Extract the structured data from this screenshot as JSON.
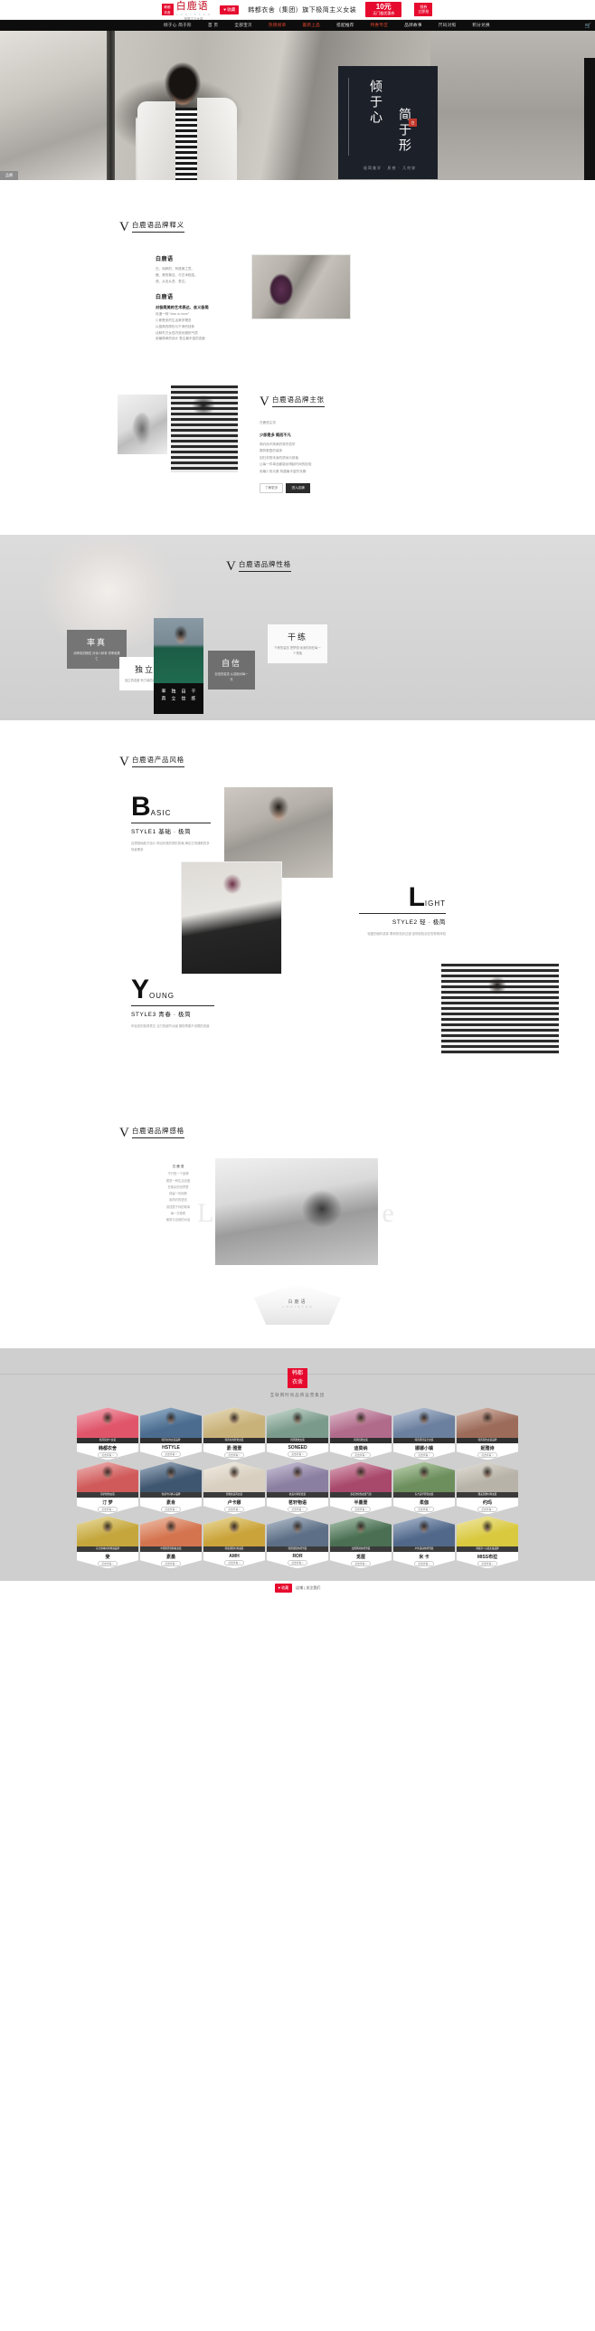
{
  "topbar": {
    "brand_badge": [
      "韩都",
      "衣舍"
    ],
    "brand_name": "白鹿语",
    "brand_pinyin": "L O U I S   T A O",
    "brand_tag": "极简主义女装",
    "fav_button": "♥ 收藏",
    "slogan": "韩都衣舍（集团）旗下极简主义女装",
    "coupon_amount": "10元",
    "coupon_condition": "无门槛优惠券",
    "coupon_tag_line1": "领券",
    "coupon_tag_line2": "立即抢"
  },
  "nav": {
    "items": [
      {
        "label": "倾于心 简于形",
        "hot": false
      },
      {
        "label": "首 页",
        "hot": false
      },
      {
        "label": "全部宝贝",
        "hot": false
      },
      {
        "label": "热销榜单",
        "hot": true
      },
      {
        "label": "最新上品",
        "hot": true
      },
      {
        "label": "搭配推荐",
        "hot": false
      },
      {
        "label": "特惠专区",
        "hot": true
      },
      {
        "label": "品牌故事",
        "hot": false
      },
      {
        "label": "尺码对照",
        "hot": false
      },
      {
        "label": "积分兑换",
        "hot": false
      }
    ],
    "cart_icon": "cart-icon"
  },
  "hero": {
    "title_line1": "倾于心",
    "title_line2": "简于形",
    "stamp": "白",
    "footnote": "极简美学 · 质感 · 几何穿",
    "tab_label": "品牌"
  },
  "section_definition": {
    "heading": "白鹿语品牌释义",
    "vmark": "V",
    "title": "白鹿语",
    "defs": [
      "白、纯粹的、有极简之意。",
      "鹿、美的象征、与艺术相连。",
      "语、从言从吾、表达。"
    ],
    "sub_title": "白鹿语",
    "sub_bold": "对极简美的艺术表达、含义极简",
    "paras": [
      "传递一种 \"less is more\"",
      "少即是多的生活美学理念",
      "以极简的廓形与干净的线条",
      "诠释东方女性内敛优雅的气质",
      "用最简单的设计 表达最丰富的态度"
    ]
  },
  "section_claim": {
    "heading": "白鹿语品牌主张",
    "vmark": "V",
    "bold": "少即是多 简而不凡",
    "paras": [
      "白鹿语主张",
      "简约而不简单的穿衣哲学",
      "摒弃繁复的装饰",
      "回归衣物本身的质地与剪裁",
      "让每一件单品都能经得起时间的检验",
      "用最少的元素 构建最丰富的衣橱"
    ],
    "buttons": [
      {
        "label": "了解更多",
        "primary": false
      },
      {
        "label": "进入店铺",
        "primary": true
      }
    ]
  },
  "section_personality": {
    "heading": "白鹿语品牌性格",
    "vmark": "V",
    "center_caption": [
      "率真",
      "独立",
      "自信",
      "干练"
    ],
    "traits": [
      {
        "title": "率真",
        "desc": "用率真的随性 对待人和事\n坦率而果仁"
      },
      {
        "title": "独立",
        "desc": "独立的态度\n有力量的自我表达"
      },
      {
        "title": "自信",
        "desc": "自信的姿态\n从容面对每一天"
      },
      {
        "title": "干练",
        "desc": "干练的姿态 把梦想\n深深的刻在每一个角落"
      }
    ]
  },
  "section_styles": {
    "heading": "白鹿语产品风格",
    "vmark": "V",
    "items": [
      {
        "letter": "B",
        "rest": "ASIC",
        "bar": "STYLE1 基础 · 极简",
        "desc": "百搭基础款式设计\n简洁利落的廓形剪裁\n满足日常通勤的多场景需求"
      },
      {
        "letter": "L",
        "rest": "IGHT",
        "bar": "STYLE2 轻 · 极简",
        "desc": "轻盈的面料选择\n柔和的色彩过渡\n呈现轻松自在的穿着体验"
      },
      {
        "letter": "Y",
        "rest": "OUNG",
        "bar": "STYLE3 青春 · 极简",
        "desc": "年轻态的极简表达\n活力的细节点缀\n展现青春不设限的态度"
      }
    ]
  },
  "section_feel": {
    "heading": "白鹿语品牌感格",
    "vmark": "V",
    "watermark": "Less is more",
    "text_lines": [
      "白 鹿 语",
      "不只是一个品牌",
      "更是一种生活态度",
      "在繁杂的世界里",
      "保留一份纯粹",
      "用简约的语言",
      "讲述属于你的故事",
      "每一次穿着",
      "都是与自我的对话"
    ],
    "logo_text": "白鹿语",
    "logo_sub": "L O U I S  T A O"
  },
  "footer": {
    "group_badge": [
      "韩都",
      "衣舍"
    ],
    "group_sub": "互联网时尚品牌运营集团",
    "rows": [
      [
        {
          "tagline": "韩风简约少女装",
          "name": "韩都衣舍",
          "enter": "点击查看 >"
        },
        {
          "tagline": "韩风时尚女装品牌",
          "name": "HSTYLE",
          "enter": "点击查看 >"
        },
        {
          "tagline": "韩风时尚轻奢女装",
          "name": "素·雅壹",
          "enter": "点击查看 >"
        },
        {
          "tagline": "韩风雅致女装",
          "name": "SONEED",
          "enter": "点击查看 >"
        },
        {
          "tagline": "韩风优雅女装",
          "name": "迪葵纳",
          "enter": "点击查看 >"
        },
        {
          "tagline": "韩风原创设计女装",
          "name": "娜娜小镇",
          "enter": "点击查看 >"
        },
        {
          "tagline": "韩风简约女装品牌",
          "name": "妮雅诗",
          "enter": "点击查看 >"
        }
      ],
      [
        {
          "tagline": "简约轻熟女装",
          "name": "汀 梦",
          "enter": "点击查看 >"
        },
        {
          "tagline": "性感牛仔裤子品牌",
          "name": "素肯",
          "enter": "点击查看 >"
        },
        {
          "tagline": "优雅欧美风女装",
          "name": "卢卡娜",
          "enter": "点击查看 >"
        },
        {
          "tagline": "欧美时尚宴会装",
          "name": "茗轩物语",
          "enter": "点击查看 >"
        },
        {
          "tagline": "多层次知性女装气质",
          "name": "半墨壹",
          "enter": "点击查看 >"
        },
        {
          "tagline": "东方美学原创女装",
          "name": "柔伽",
          "enter": "点击查看 >"
        },
        {
          "tagline": "甜美优雅时尚女装",
          "name": "约玛",
          "enter": "点击查看 >"
        }
      ],
      [
        {
          "tagline": "东方韵味时尚棉麻品牌",
          "name": "斐",
          "enter": "点击查看 >"
        },
        {
          "tagline": "中国风原创棉麻女装",
          "name": "素墨",
          "enter": "点击查看 >"
        },
        {
          "tagline": "韩版潮流时尚童装",
          "name": "AMH",
          "enter": "点击查看 >"
        },
        {
          "tagline": "韩国潮流休闲男装",
          "name": "ROR",
          "enter": "点击查看 >"
        },
        {
          "tagline": "法国风尚休闲男装",
          "name": "觅厘",
          "enter": "点击查看 >"
        },
        {
          "tagline": "户外运动休闲男装",
          "name": "米 卡",
          "enter": "点击查看 >"
        },
        {
          "tagline": "韩版亲􏰀子装女童品牌",
          "name": "MISS布拉",
          "enter": "点击查看 >"
        }
      ]
    ],
    "bottom_badge": "♥ 收藏",
    "bottom_text": "店铺 | 关注我们"
  }
}
